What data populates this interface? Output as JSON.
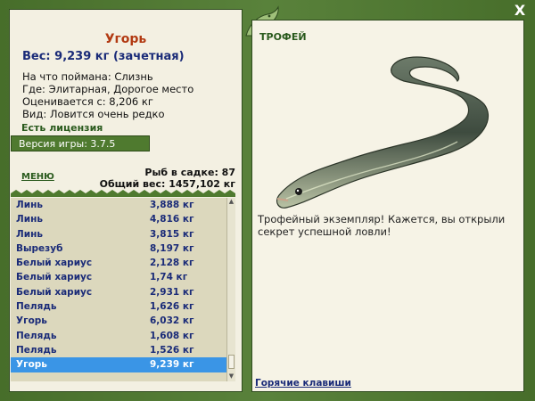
{
  "window": {
    "close_label": "X"
  },
  "fish": {
    "name": "Угорь",
    "weight": "Вес: 9,239 кг (зачетная)",
    "bait": "На что поймана: Слизнь",
    "location": "Где: Элитарная, Дорогое место",
    "value": "Оценивается с: 8,206 кг",
    "rarity": "Вид: Ловится очень редко"
  },
  "license": "Есть лицензия",
  "version": "Версия игры: 3.7.5",
  "menu_label": "МЕНЮ",
  "stats": {
    "count": "Рыб в садке: 87",
    "total": "Общий вес: 1457,102 кг"
  },
  "catch_list": [
    {
      "name": "Линь",
      "weight": "3,888 кг"
    },
    {
      "name": "Линь",
      "weight": "4,816 кг"
    },
    {
      "name": "Линь",
      "weight": "3,815 кг"
    },
    {
      "name": "Вырезуб",
      "weight": "8,197 кг"
    },
    {
      "name": "Белый хариус",
      "weight": "2,128 кг"
    },
    {
      "name": "Белый хариус",
      "weight": "1,74 кг"
    },
    {
      "name": "Белый хариус",
      "weight": "2,931 кг"
    },
    {
      "name": "Пелядь",
      "weight": "1,626 кг"
    },
    {
      "name": "Угорь",
      "weight": "6,032 кг"
    },
    {
      "name": "Пелядь",
      "weight": "1,608 кг"
    },
    {
      "name": "Пелядь",
      "weight": "1,526 кг"
    },
    {
      "name": "Угорь",
      "weight": "9,239 кг",
      "selected": true
    }
  ],
  "trophy": {
    "label": "ТРОФЕЙ",
    "description": "Трофейный экземпляр! Кажется, вы открыли секрет успешной ловли!"
  },
  "hotkeys_label": "Горячие клавиши",
  "colors": {
    "frame": "#4f7a2f",
    "panel": "#f3f0e2",
    "list_bg": "#dcd8bd",
    "selected": "#3a95e6",
    "title": "#b23a12",
    "text_blue": "#1a2b78"
  }
}
